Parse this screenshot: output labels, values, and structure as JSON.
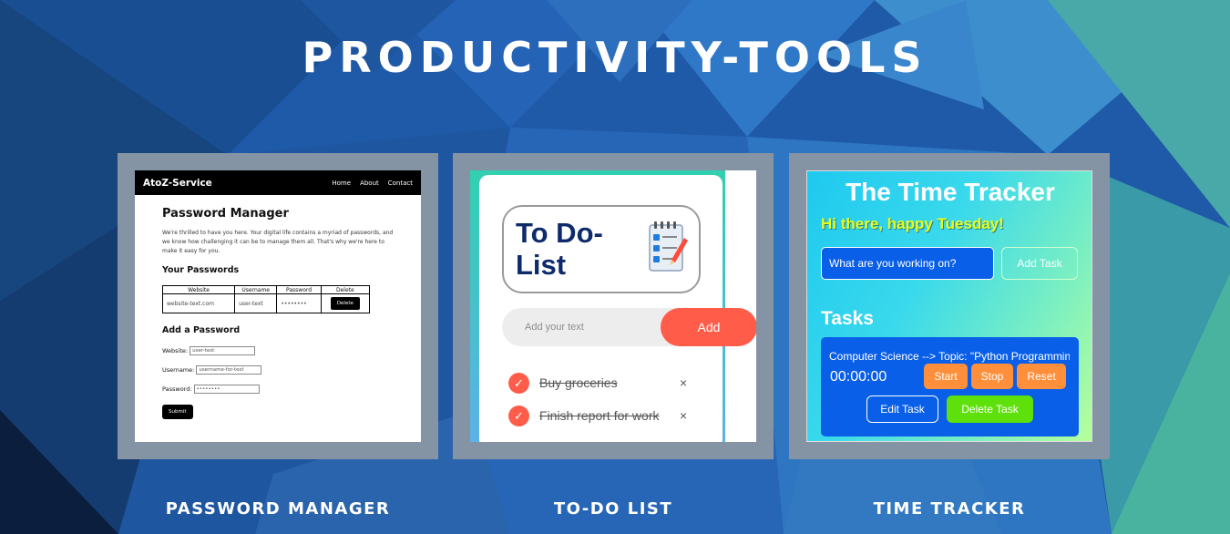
{
  "page_title": "PRODUCTIVITY-TOOLS",
  "cards": {
    "password": {
      "caption": "PASSWORD MANAGER",
      "brand": "AtoZ-Service",
      "nav": [
        "Home",
        "About",
        "Contact"
      ],
      "heading": "Password Manager",
      "intro": "We're thrilled to have you here. Your digital life contains a myriad of passwords, and we know how challenging it can be to manage them all. That's why we're here to make it easy for you.",
      "your_passwords": "Your Passwords",
      "columns": [
        "Website",
        "Username",
        "Password",
        "Delete"
      ],
      "row": {
        "website": "website-text.com",
        "username": "user-text",
        "password": "••••••••",
        "delete": "Delete"
      },
      "add_heading": "Add a Password",
      "website_label": "Website:",
      "website_value": "user-test",
      "username_label": "Username:",
      "username_value": "username-for-test",
      "password_label": "Password:",
      "password_value": "••••••••",
      "submit": "Submit"
    },
    "todo": {
      "caption": "TO-DO LIST",
      "heading_line1": "To Do-",
      "heading_line2": "List",
      "placeholder": "Add your text",
      "add": "Add",
      "items": [
        "Buy groceries",
        "Finish report for work"
      ],
      "check": "✓",
      "remove": "×"
    },
    "time": {
      "caption": "TIME TRACKER",
      "heading": "The Time Tracker",
      "greeting": "Hi there, happy Tuesday!",
      "input_placeholder": "What are you working on?",
      "add_task": "Add Task",
      "tasks_heading": "Tasks",
      "task_text": "Computer Science --> Topic: \"Python Programming\"",
      "timer": "00:00:00",
      "start": "Start",
      "stop": "Stop",
      "reset": "Reset",
      "edit": "Edit Task",
      "delete": "Delete Task"
    }
  }
}
